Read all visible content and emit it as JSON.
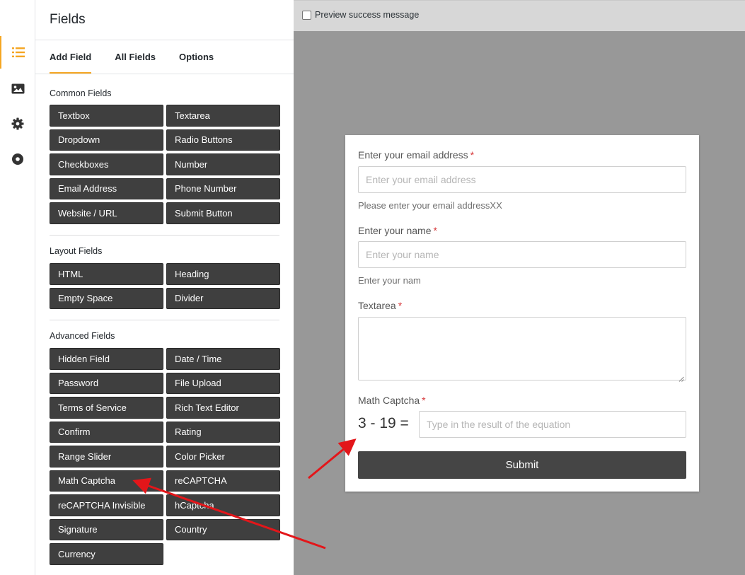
{
  "rail": {
    "items": [
      {
        "icon": "list-icon",
        "active": true
      },
      {
        "icon": "image-icon",
        "active": false
      },
      {
        "icon": "gear-icon",
        "active": false
      },
      {
        "icon": "record-icon",
        "active": false
      }
    ],
    "accent": "#f5a623"
  },
  "panel": {
    "title": "Fields",
    "tabs": [
      {
        "label": "Add Field",
        "active": true
      },
      {
        "label": "All Fields",
        "active": false
      },
      {
        "label": "Options",
        "active": false
      }
    ],
    "sections": {
      "common": {
        "label": "Common Fields",
        "buttons": [
          "Textbox",
          "Textarea",
          "Dropdown",
          "Radio Buttons",
          "Checkboxes",
          "Number",
          "Email Address",
          "Phone Number",
          "Website / URL",
          "Submit Button"
        ]
      },
      "layout": {
        "label": "Layout Fields",
        "buttons": [
          "HTML",
          "Heading",
          "Empty Space",
          "Divider"
        ]
      },
      "advanced": {
        "label": "Advanced Fields",
        "buttons": [
          "Hidden Field",
          "Date / Time",
          "Password",
          "File Upload",
          "Terms of Service",
          "Rich Text Editor",
          "Confirm",
          "Rating",
          "Range Slider",
          "Color Picker",
          "Math Captcha",
          "reCAPTCHA",
          "reCAPTCHA Invisible",
          "hCaptcha",
          "Signature",
          "Country",
          "Currency"
        ]
      }
    },
    "button_color": "#3f3f3f"
  },
  "preview": {
    "checkbox_label": "Preview success message",
    "checkbox_checked": false,
    "form": {
      "email": {
        "label": "Enter your email address",
        "required_mark": "*",
        "placeholder": "Enter your email address",
        "help": "Please enter your email addressXX"
      },
      "name": {
        "label": "Enter your name",
        "required_mark": "*",
        "placeholder": "Enter your name",
        "help": "Enter your nam"
      },
      "textarea": {
        "label": "Textarea",
        "required_mark": "*"
      },
      "captcha": {
        "label": "Math Captcha",
        "required_mark": "*",
        "equation": "3 - 19 =",
        "placeholder": "Type in the result of the equation"
      },
      "submit_label": "Submit"
    },
    "required_color": "#d63638",
    "annotation_color": "#e3161a"
  }
}
